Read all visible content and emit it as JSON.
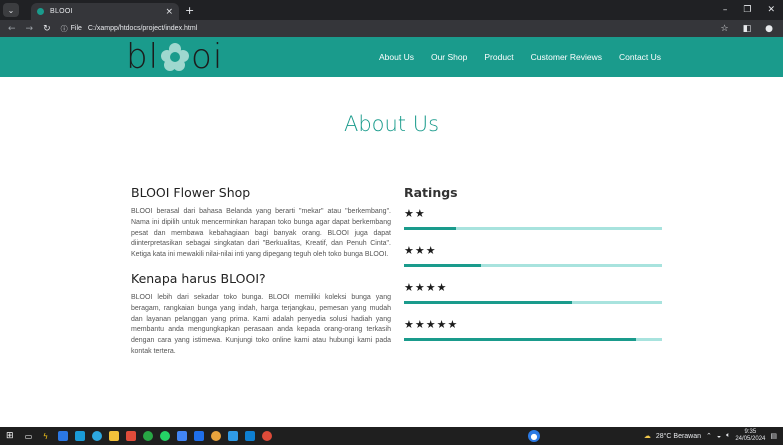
{
  "browser": {
    "tab_title": "BLOOI",
    "tab_close": "×",
    "new_tab": "+",
    "url_scheme": "File",
    "url": "C:/xampp/htdocs/project/index.html"
  },
  "site": {
    "logo_left": "bl",
    "logo_right": "oi",
    "nav": [
      {
        "label": "About Us"
      },
      {
        "label": "Our Shop"
      },
      {
        "label": "Product"
      },
      {
        "label": "Customer Reviews"
      },
      {
        "label": "Contact Us"
      }
    ]
  },
  "main": {
    "title": "About Us",
    "shop_heading": "BLOOI Flower Shop",
    "shop_text": "BLOOI berasal dari bahasa Belanda yang berarti \"mekar\" atau \"berkembang\". Nama ini dipilih untuk mencerminkan harapan toko bunga agar dapat berkembang pesat dan membawa kebahagiaan bagi banyak orang. BLOOI juga dapat diinterpretasikan sebagai singkatan dari \"Berkualitas, Kreatif, dan Penuh Cinta\". Ketiga kata ini mewakili nilai-nilai inti yang dipegang teguh oleh toko bunga BLOOI.",
    "why_heading": "Kenapa harus BLOOI?",
    "why_text": "BLOOI lebih dari sekadar toko bunga. BLOOI memiliki koleksi bunga yang beragam, rangkaian bunga yang indah, harga terjangkau, pemesan yang mudah dan layanan pelanggan yang prima. Kami adalah penyedia solusi hadiah yang membantu anda mengungkapkan perasaan anda kepada orang-orang terkasih dengan cara yang istimewa. Kunjungi toko online kami atau hubungi kami pada kontak tertera.",
    "ratings_heading": "Ratings",
    "ratings": [
      {
        "stars": "★★",
        "fill": 0.2
      },
      {
        "stars": "★★★",
        "fill": 0.3
      },
      {
        "stars": "★★★★",
        "fill": 0.65
      },
      {
        "stars": "★★★★★",
        "fill": 0.9
      }
    ]
  },
  "taskbar": {
    "weather": "28°C  Berawan",
    "time": "9:35",
    "date": "24/05/2024"
  },
  "colors": {
    "brand": "#1a9b8c",
    "bar_track": "#a8e3de"
  }
}
